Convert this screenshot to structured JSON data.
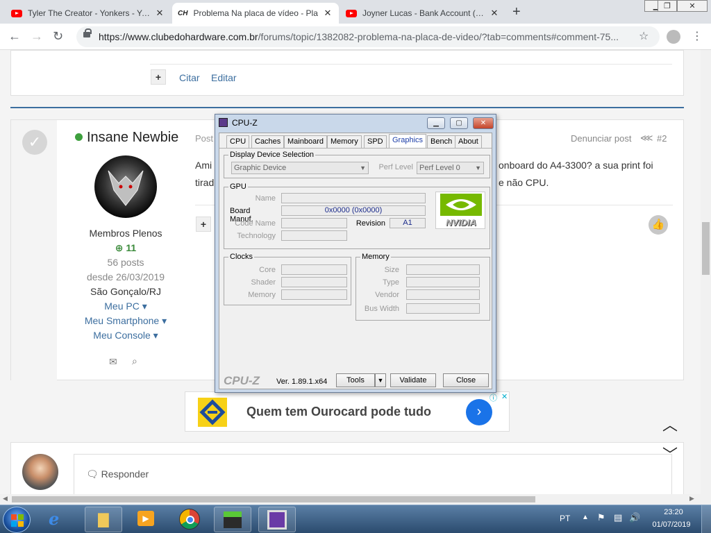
{
  "browser": {
    "tabs": [
      {
        "title": "Tyler The Creator - Yonkers - You",
        "icon": "youtube-icon"
      },
      {
        "title": "Problema Na placa de vídeo - Pla",
        "icon": "clubedohardware-icon"
      },
      {
        "title": "Joyner Lucas - Bank Account (Re",
        "icon": "youtube-icon"
      }
    ],
    "url_main": "https://www.clubedohardware.com.br",
    "url_rest": "/forums/topic/1382082-problema-na-placa-de-video/?tab=comments#comment-75..."
  },
  "post_top": {
    "actions": [
      "Citar",
      "Editar"
    ]
  },
  "post": {
    "author": "Insane Newbie",
    "posted_prefix": "Post",
    "report": "Denunciar post",
    "number": "#2",
    "text_line1_start": "Ami",
    "text_line1_end": "onboard do A4-3300? a sua print foi",
    "text_line2_start": "tirad",
    "text_line2_end": "e não CPU.",
    "rank": "Membros Plenos",
    "reputation": "11",
    "posts": "56 posts",
    "since": "desde 26/03/2019",
    "location": "São Gonçalo/RJ",
    "links": [
      "Meu PC",
      "Meu Smartphone",
      "Meu Console"
    ]
  },
  "ad": {
    "text": "Quem tem Ourocard pode tudo",
    "brand_color": "#f7d117"
  },
  "reply": {
    "placeholder": "Responder"
  },
  "cpuz": {
    "title": "CPU-Z",
    "tabs": [
      "CPU",
      "Caches",
      "Mainboard",
      "Memory",
      "SPD",
      "Graphics",
      "Bench",
      "About"
    ],
    "active_tab": "Graphics",
    "display_selection": {
      "label": "Display Device Selection",
      "device": "Graphic Device",
      "perf_label": "Perf Level",
      "perf_value": "Perf Level 0"
    },
    "gpu": {
      "label": "GPU",
      "name_label": "Name",
      "board_manuf_label": "Board Manuf.",
      "board_manuf_value": "0x0000 (0x0000)",
      "code_name_label": "Code Name",
      "revision_label": "Revision",
      "revision_value": "A1",
      "technology_label": "Technology",
      "logo_text": "NVIDIA"
    },
    "clocks": {
      "label": "Clocks",
      "core": "Core",
      "shader": "Shader",
      "memory": "Memory"
    },
    "memory": {
      "label": "Memory",
      "size": "Size",
      "type": "Type",
      "vendor": "Vendor",
      "bus_width": "Bus Width"
    },
    "footer": {
      "brand": "CPU-Z",
      "version": "Ver. 1.89.1.x64",
      "tools": "Tools",
      "validate": "Validate",
      "close": "Close"
    }
  },
  "taskbar": {
    "language": "PT",
    "time": "23:20",
    "date": "01/07/2019"
  }
}
